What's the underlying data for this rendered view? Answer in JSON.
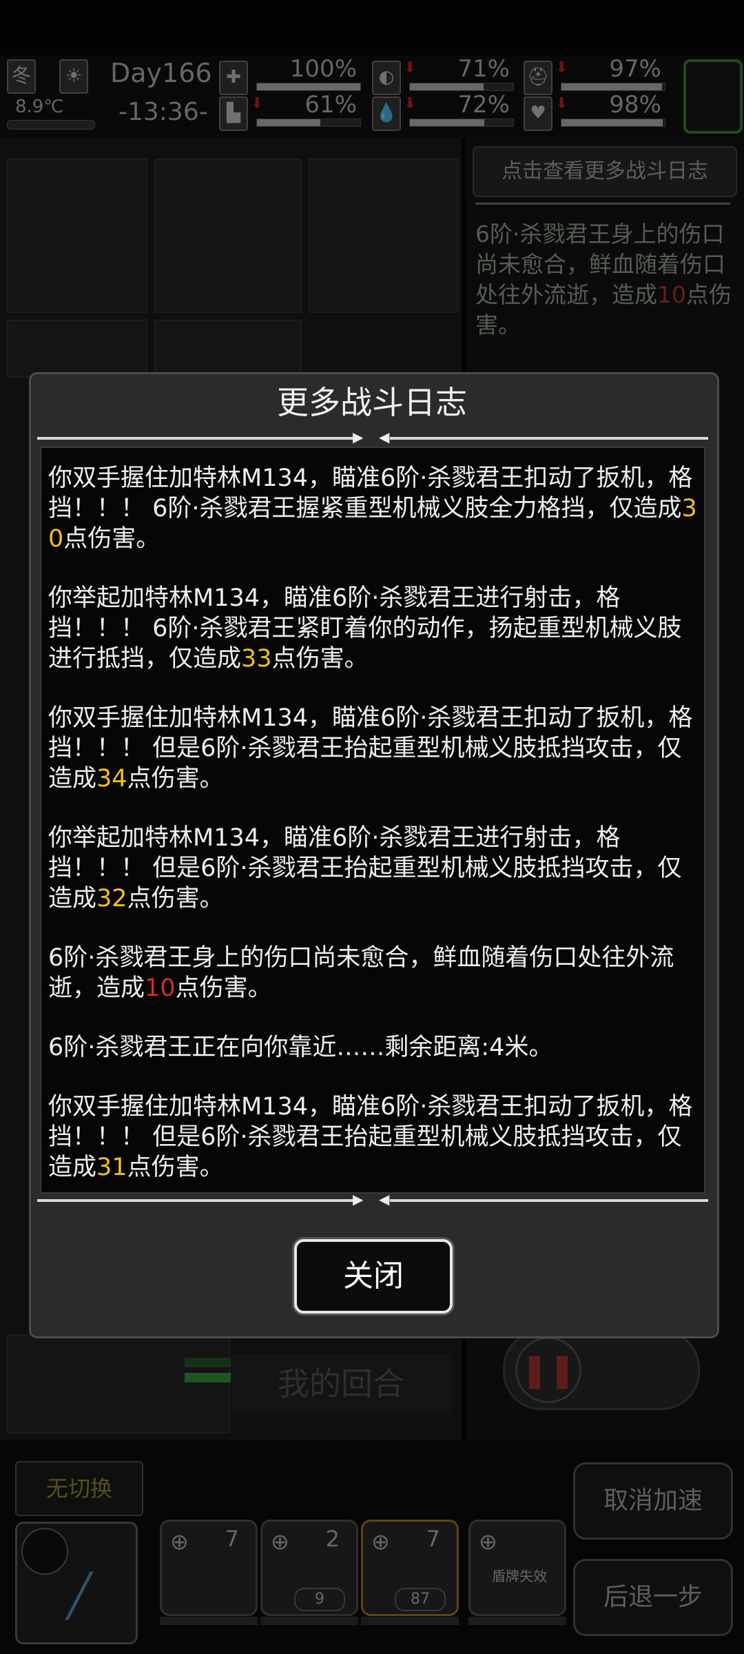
{
  "status": {
    "season": "冬",
    "weather_icon": "sun-icon",
    "temperature": "8.9℃",
    "day": "Day166",
    "time": "-13:36-",
    "stats": [
      {
        "icon": "medkit-icon",
        "pct": "100%",
        "fill": 1.0,
        "down": false
      },
      {
        "icon": "stomach-icon",
        "pct": "71%",
        "fill": 0.71,
        "down": true
      },
      {
        "icon": "helmet-icon",
        "pct": "97%",
        "fill": 0.97,
        "down": true
      },
      {
        "icon": "boot-icon",
        "pct": "61%",
        "fill": 0.61,
        "down": true
      },
      {
        "icon": "water-drop-icon",
        "pct": "72%",
        "fill": 0.72,
        "down": true
      },
      {
        "icon": "heart-icon",
        "pct": "98%",
        "fill": 0.98,
        "down": true
      }
    ]
  },
  "right_panel": {
    "more_logs_button": "点击查看更多战斗日志",
    "log_text_a": "6阶·杀戮君王身上的伤口尚未愈合，鲜血随着伤口处往外流逝，造成",
    "log_num": "10",
    "log_text_b": "点伤害。"
  },
  "board": {
    "my_turn_label": "我的回合"
  },
  "bottom": {
    "no_switch": "无切换",
    "slots": [
      {
        "count": "7",
        "sub": ""
      },
      {
        "count": "2",
        "sub": "9"
      },
      {
        "count": "7",
        "sub": "87"
      },
      {
        "count": "",
        "sub": "盾牌失效"
      }
    ],
    "cancel_speed": "取消加速",
    "step_back": "后退一步"
  },
  "dialog": {
    "title": "更多战斗日志",
    "close_label": "关闭",
    "entries": [
      {
        "a": "你双手握住加特林M134，瞄准6阶·杀戮君王扣动了扳机，格挡！！！ 6阶·杀戮君王握紧重型机械义肢全力格挡，仅造成",
        "n": "30",
        "b": "点伤害。",
        "color": "yellow"
      },
      {
        "a": "你举起加特林M134，瞄准6阶·杀戮君王进行射击，格挡！！！ 6阶·杀戮君王紧盯着你的动作，扬起重型机械义肢进行抵挡，仅造成",
        "n": "33",
        "b": "点伤害。",
        "color": "yellow"
      },
      {
        "a": "你双手握住加特林M134，瞄准6阶·杀戮君王扣动了扳机，格挡！！！ 但是6阶·杀戮君王抬起重型机械义肢抵挡攻击，仅造成",
        "n": "34",
        "b": "点伤害。",
        "color": "yellow"
      },
      {
        "a": "你举起加特林M134，瞄准6阶·杀戮君王进行射击，格挡！！！ 但是6阶·杀戮君王抬起重型机械义肢抵挡攻击，仅造成",
        "n": "32",
        "b": "点伤害。",
        "color": "yellow"
      },
      {
        "a": "6阶·杀戮君王身上的伤口尚未愈合，鲜血随着伤口处往外流逝，造成",
        "n": "10",
        "b": "点伤害。",
        "color": "red"
      },
      {
        "a": "6阶·杀戮君王正在向你靠近……剩余距离:4米。",
        "n": "",
        "b": "",
        "color": "none"
      },
      {
        "a": "你双手握住加特林M134，瞄准6阶·杀戮君王扣动了扳机，格挡！！！ 但是6阶·杀戮君王抬起重型机械义肢抵挡攻击，仅造成",
        "n": "31",
        "b": "点伤害。",
        "color": "yellow"
      }
    ]
  }
}
